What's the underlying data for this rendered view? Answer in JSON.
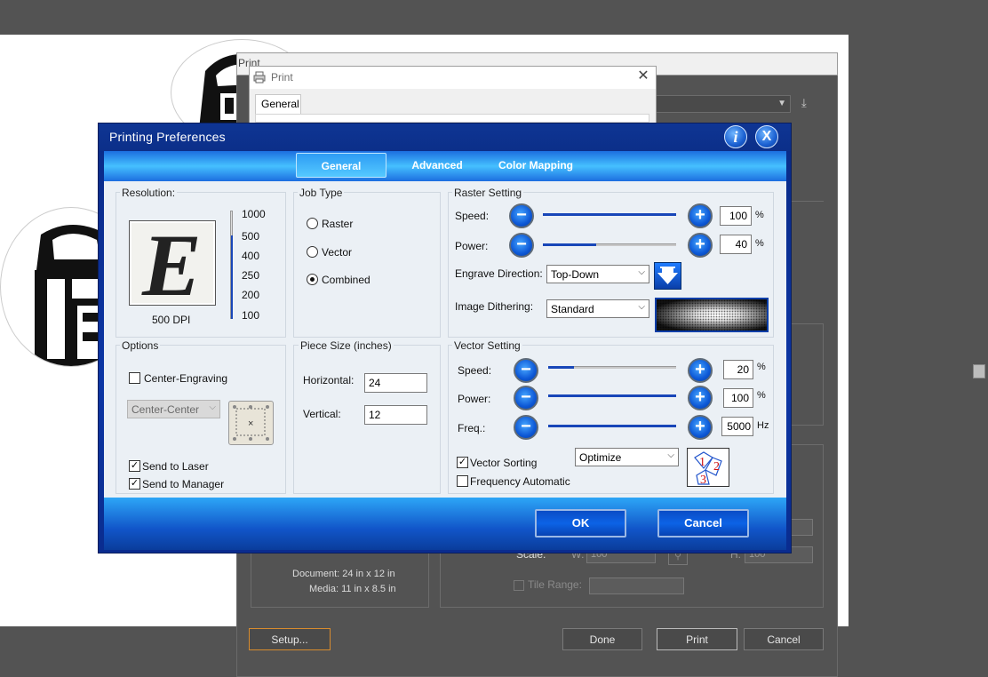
{
  "background_app": {
    "print_title": "Print",
    "document_size": "Document: 24 in x 12 in",
    "media_size": "Media: 11 in x 8.5 in",
    "scale_label": "Scale:",
    "w_label": "W:",
    "w_value": "100",
    "h_label": "H:",
    "h_value": "100",
    "tile_range_label": "Tile Range:",
    "setup_button": "Setup...",
    "done_button": "Done",
    "print_button": "Print",
    "cancel_button": "Cancel"
  },
  "windows_print": {
    "title": "Print",
    "tab_general": "General",
    "close_glyph": "✕"
  },
  "printing_preferences": {
    "title": "Printing Preferences",
    "info_glyph": "i",
    "close_glyph": "X",
    "tabs": [
      "General",
      "Advanced",
      "Color Mapping"
    ],
    "active_tab": "General",
    "resolution": {
      "label": "Resolution:",
      "preview_letter": "E",
      "dpi_text": "500 DPI",
      "dpi_value": 500,
      "scale_ticks": [
        "1000",
        "500",
        "400",
        "250",
        "200",
        "100"
      ]
    },
    "job_type": {
      "label": "Job Type",
      "options": [
        "Raster",
        "Vector",
        "Combined"
      ],
      "selected": "Combined"
    },
    "raster_setting": {
      "label": "Raster Setting",
      "speed_label": "Speed:",
      "speed_value": "100",
      "speed_unit": "%",
      "speed_fraction": 1.0,
      "power_label": "Power:",
      "power_value": "40",
      "power_unit": "%",
      "power_fraction": 0.4,
      "engrave_direction_label": "Engrave Direction:",
      "engrave_direction_value": "Top-Down",
      "image_dithering_label": "Image Dithering:",
      "image_dithering_value": "Standard"
    },
    "options": {
      "label": "Options",
      "center_engraving_label": "Center-Engraving",
      "center_engraving_checked": false,
      "center_select_value": "Center-Center",
      "send_to_laser_label": "Send to Laser",
      "send_to_laser_checked": true,
      "send_to_manager_label": "Send to Manager",
      "send_to_manager_checked": true
    },
    "piece_size": {
      "label": "Piece Size (inches)",
      "horizontal_label": "Horizontal:",
      "horizontal_value": "24",
      "vertical_label": "Vertical:",
      "vertical_value": "12"
    },
    "vector_setting": {
      "label": "Vector Setting",
      "speed_label": "Speed:",
      "speed_value": "20",
      "speed_unit": "%",
      "speed_fraction": 0.2,
      "power_label": "Power:",
      "power_value": "100",
      "power_unit": "%",
      "power_fraction": 1.0,
      "freq_label": "Freq.:",
      "freq_value": "5000",
      "freq_unit": "Hz",
      "freq_fraction": 1.0,
      "vector_sorting_label": "Vector Sorting",
      "vector_sorting_checked": true,
      "optimize_value": "Optimize",
      "frequency_automatic_label": "Frequency Automatic",
      "frequency_automatic_checked": false,
      "sorting_icon_digits": [
        "1",
        "2",
        "3"
      ]
    },
    "ok_button": "OK",
    "cancel_button": "Cancel"
  },
  "colors": {
    "dialog_blue": "#0c36a4",
    "tab_band_light": "#45c0ff",
    "body_bg": "#ebf0f5",
    "slider_fill": "#1846b8",
    "app_dark": "#535353"
  }
}
